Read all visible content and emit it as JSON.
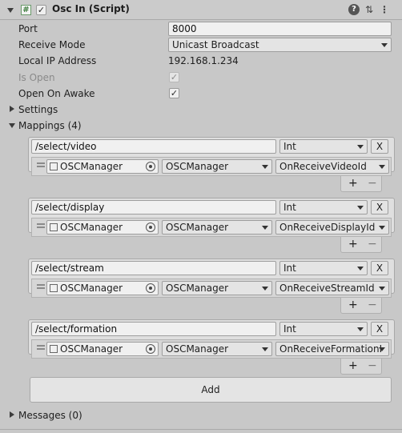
{
  "header": {
    "title": "Osc In (Script)",
    "enabled": true
  },
  "fields": {
    "port_label": "Port",
    "port_value": "8000",
    "receive_mode_label": "Receive Mode",
    "receive_mode_value": "Unicast Broadcast",
    "local_ip_label": "Local IP Address",
    "local_ip_value": "192.168.1.234",
    "is_open_label": "Is Open",
    "is_open_checked": true,
    "open_on_awake_label": "Open On Awake",
    "open_on_awake_checked": true
  },
  "settings_label": "Settings",
  "mappings_label": "Mappings (4)",
  "mappings": [
    {
      "address": "/select/video",
      "type": "Int",
      "remove": "X",
      "object": "OSCManager",
      "component": "OSCManager",
      "method": "OnReceiveVideoId"
    },
    {
      "address": "/select/display",
      "type": "Int",
      "remove": "X",
      "object": "OSCManager",
      "component": "OSCManager",
      "method": "OnReceiveDisplayId"
    },
    {
      "address": "/select/stream",
      "type": "Int",
      "remove": "X",
      "object": "OSCManager",
      "component": "OSCManager",
      "method": "OnReceiveStreamId"
    },
    {
      "address": "/select/formation",
      "type": "Int",
      "remove": "X",
      "object": "OSCManager",
      "component": "OSCManager",
      "method": "OnReceiveFormationI"
    }
  ],
  "plus": "+",
  "minus": "−",
  "add_label": "Add",
  "messages_label": "Messages (0)"
}
